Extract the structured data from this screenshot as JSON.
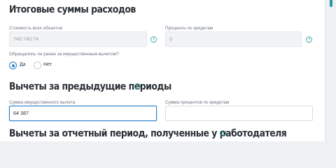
{
  "sections": {
    "totals": {
      "title": "Итоговые суммы расходов",
      "property_cost_label": "Стоимость всех объектов",
      "property_cost_value": "740 740.74",
      "credit_interest_label": "Проценты по кредитам",
      "credit_interest_placeholder": "0",
      "prior_deduction_question": "Обращались ли ранее за имущественным вычетом?",
      "radio_yes": "Да",
      "radio_no": "Нет",
      "selected_option": "Да"
    },
    "previous_periods": {
      "title": "Вычеты за предыдущие периоды",
      "property_deduction_label": "Сумма имущественного вычета",
      "property_deduction_value": "64 387",
      "interest_amount_label": "Сумма процентов по кредитам",
      "interest_amount_value": ""
    },
    "reporting_period": {
      "title": "Вычеты за отчетный период, полученные у работодателя"
    }
  },
  "colors": {
    "accent_blue": "#2a7fc7",
    "help_icon": "#2a9b9b",
    "teal_strip": "#2a9b9b"
  },
  "icons": [
    "help-icon",
    "radio-checked",
    "radio-unchecked"
  ]
}
